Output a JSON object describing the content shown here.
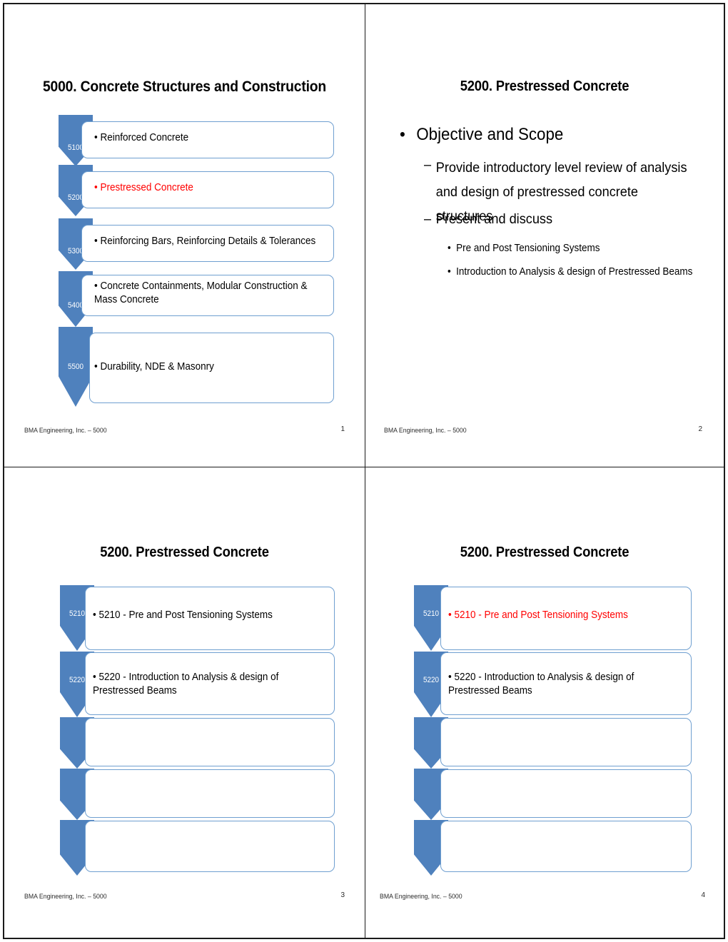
{
  "document": {
    "kind": "presentation-handout",
    "slides_per_page": 4
  },
  "theme": {
    "accent_blue": "#4F81BD",
    "box_border_blue": "#6F9FD0",
    "highlight_red": "#FF0000",
    "text_black": "#000000"
  },
  "footer": {
    "label": "BMA Engineering, Inc. – 5000"
  },
  "slides": [
    {
      "number": "1",
      "title": "5000. Concrete Structures and Construction",
      "type": "chevron-list",
      "items": [
        {
          "code": "5100",
          "text": "• Reinforced Concrete",
          "highlight": false
        },
        {
          "code": "5200",
          "text": "• Prestressed Concrete",
          "highlight": true
        },
        {
          "code": "5300",
          "text": "• Reinforcing Bars, Reinforcing Details & Tolerances",
          "highlight": false
        },
        {
          "code": "5400",
          "text": "• Concrete Containments, Modular Construction &\nMass Concrete",
          "highlight": false
        },
        {
          "code": "5500",
          "text": "• Durability, NDE & Masonry",
          "highlight": false
        }
      ]
    },
    {
      "number": "2",
      "title": "5200. Prestressed Concrete",
      "type": "bullet-outline",
      "bullets": [
        {
          "level": 1,
          "marker": "•",
          "text": "Objective and Scope"
        },
        {
          "level": 2,
          "marker": "–",
          "text": "Provide introductory level review of analysis and design of prestressed concrete structures"
        },
        {
          "level": 2,
          "marker": "–",
          "text": "Present and discuss"
        },
        {
          "level": 3,
          "marker": "•",
          "text": "Pre and Post Tensioning Systems"
        },
        {
          "level": 3,
          "marker": "•",
          "text": "Introduction to Analysis & design of Prestressed Beams"
        }
      ]
    },
    {
      "number": "3",
      "title": "5200. Prestressed Concrete",
      "type": "chevron-list",
      "items": [
        {
          "code": "5210",
          "text": "• 5210 - Pre and Post Tensioning Systems",
          "highlight": false
        },
        {
          "code": "5220",
          "text": "• 5220 - Introduction to Analysis & design of\nPrestressed Beams",
          "highlight": false
        },
        {
          "code": "",
          "text": "",
          "highlight": false
        },
        {
          "code": "",
          "text": "",
          "highlight": false
        },
        {
          "code": "",
          "text": "",
          "highlight": false
        }
      ]
    },
    {
      "number": "4",
      "title": "5200. Prestressed Concrete",
      "type": "chevron-list",
      "items": [
        {
          "code": "5210",
          "text": "• 5210 - Pre and Post Tensioning Systems",
          "highlight": true
        },
        {
          "code": "5220",
          "text": "• 5220 - Introduction to Analysis & design of\nPrestressed Beams",
          "highlight": false
        },
        {
          "code": "",
          "text": "",
          "highlight": false
        },
        {
          "code": "",
          "text": "",
          "highlight": false
        },
        {
          "code": "",
          "text": "",
          "highlight": false
        }
      ]
    }
  ]
}
